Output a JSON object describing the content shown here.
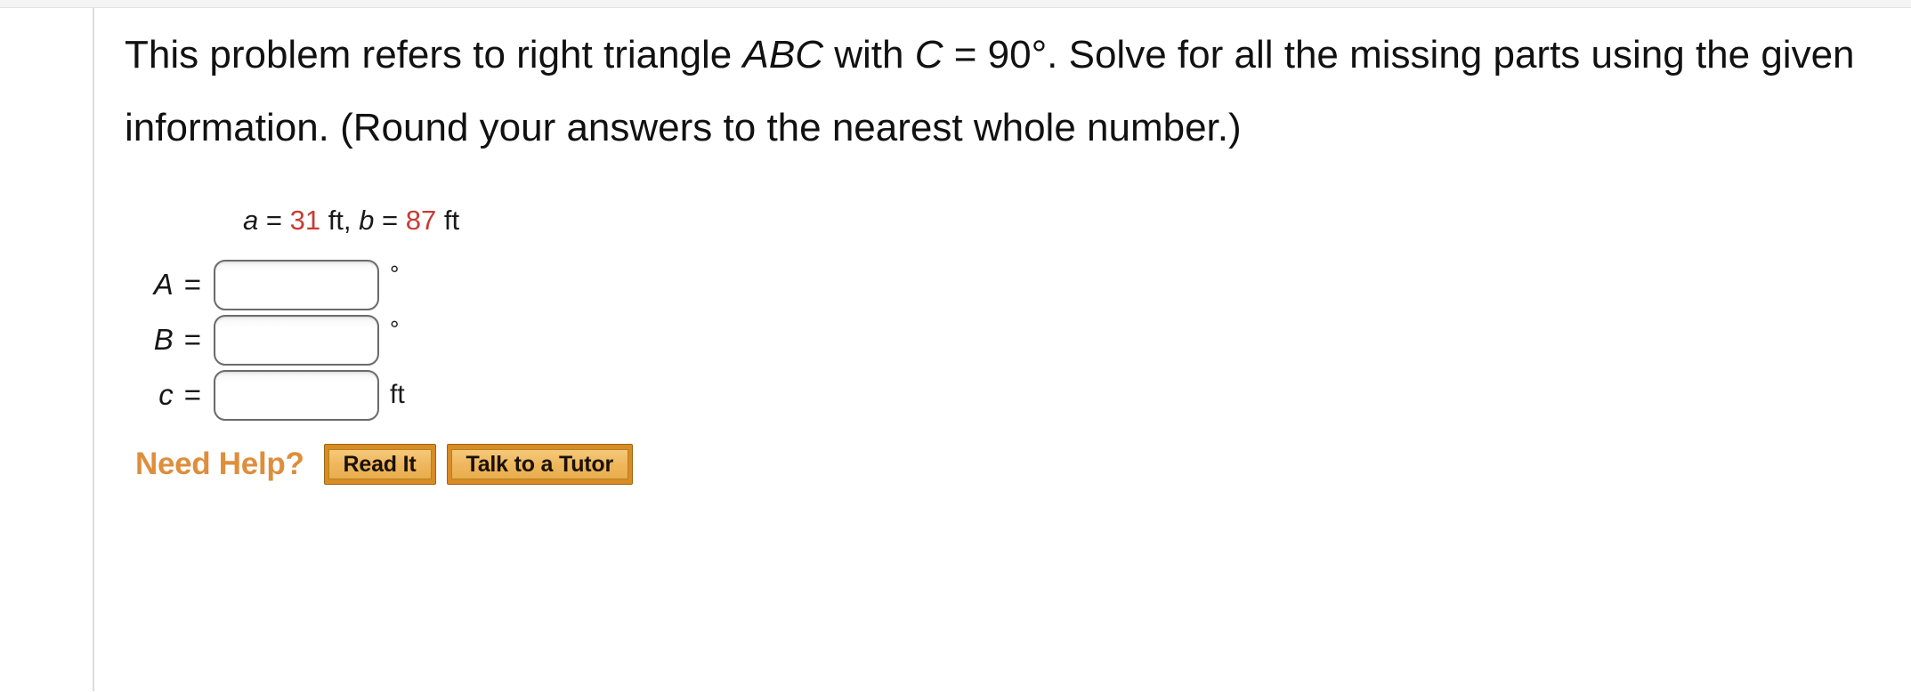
{
  "problem": {
    "statement_parts": [
      {
        "text": "This problem refers to right triangle ",
        "style": "normal"
      },
      {
        "text": "ABC",
        "style": "italic"
      },
      {
        "text": " with ",
        "style": "normal"
      },
      {
        "text": "C",
        "style": "italic"
      },
      {
        "text": " = 90°. Solve for all the missing parts using the given information. (Round your answers to the nearest whole number.)",
        "style": "normal"
      }
    ],
    "statement_text": "This problem refers to right triangle ABC with C = 90°. Solve for all the missing parts using the given information. (Round your answers to the nearest whole number.)",
    "statement_line1_a": "This problem refers to right triangle ",
    "statement_var_abc": "ABC",
    "statement_with": " with ",
    "statement_var_c": "C",
    "statement_rest": " = 90°. Solve for all the missing parts using the given information. (Round your answers to the nearest whole number.)"
  },
  "given": {
    "var_a": "a",
    "eq1": " = ",
    "value_a": "31",
    "unit_a": " ft, ",
    "var_b": "b",
    "eq2": " = ",
    "value_b": "87",
    "unit_b": " ft",
    "full_text": "a = 31 ft, b = 87 ft",
    "value_color": "#c93b33"
  },
  "answers": [
    {
      "label_var": "A",
      "label_eq": "=",
      "value": "",
      "placeholder": "",
      "unit": "°",
      "unit_kind": "degree"
    },
    {
      "label_var": "B",
      "label_eq": "=",
      "value": "",
      "placeholder": "",
      "unit": "°",
      "unit_kind": "degree"
    },
    {
      "label_var": "c",
      "label_eq": "=",
      "value": "",
      "placeholder": "",
      "unit": "ft",
      "unit_kind": "text"
    }
  ],
  "help": {
    "label": "Need Help?",
    "label_color": "#de8e3c",
    "buttons": [
      {
        "label": "Read It"
      },
      {
        "label": "Talk to a Tutor"
      }
    ]
  }
}
